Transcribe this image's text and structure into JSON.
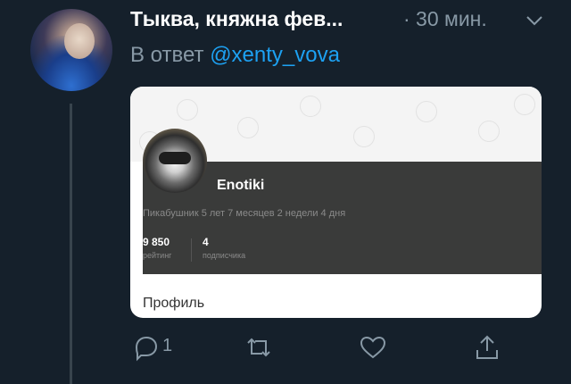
{
  "tweet": {
    "author_name": "Тыква, княжна фев...",
    "time": "· 30 мин.",
    "reply_prefix": "В ответ",
    "reply_mention": "@xenty_vova",
    "reply_count": "1"
  },
  "card": {
    "profile_name": "Enotiki",
    "member_since": "Пикабушник 5 лет 7 месяцев 2 недели 4 дня",
    "stats": [
      {
        "value": "9 850",
        "label": "рейтинг"
      },
      {
        "value": "4",
        "label": "подписчика"
      }
    ],
    "tab_label": "Профиль"
  },
  "icons": {
    "more": "chevron-down-icon",
    "reply": "comment-icon",
    "retweet": "retweet-icon",
    "like": "heart-icon",
    "share": "share-icon"
  },
  "colors": {
    "background": "#15202b",
    "accent": "#1da1f2",
    "secondary_text": "#8899a6"
  }
}
